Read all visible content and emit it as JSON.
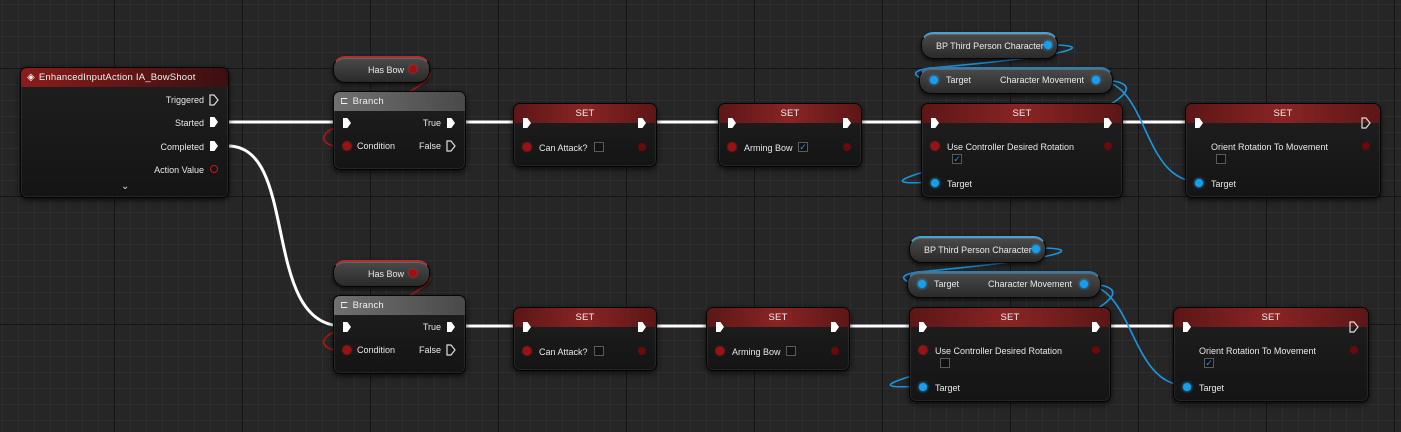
{
  "event": {
    "title": "EnhancedInputAction IA_BowShoot",
    "triggered": "Triggered",
    "started": "Started",
    "completed": "Completed",
    "action_value": "Action Value"
  },
  "has_bow": "Has Bow",
  "branch": {
    "title": "Branch",
    "condition": "Condition",
    "true_label": "True",
    "false_label": "False"
  },
  "set_title": "SET",
  "vars": {
    "can_attack": "Can Attack?",
    "arming_bow": "Arming Bow",
    "use_ctrl_rot": "Use Controller Desired Rotation",
    "orient_rot": "Orient Rotation To Movement",
    "target": "Target",
    "bp_char": "BP Third Person Character",
    "char_movement": "Character Movement"
  },
  "row1": {
    "can_attack": false,
    "arming_bow": true,
    "use_ctrl_rot": true,
    "orient_rot": false
  },
  "row2": {
    "can_attack": false,
    "arming_bow": false,
    "use_ctrl_rot": false,
    "orient_rot": true
  },
  "colors": {
    "exec": "#ffffff",
    "bool": "#a01010",
    "object": "#14a0f0",
    "header_set": "#8a2424"
  }
}
